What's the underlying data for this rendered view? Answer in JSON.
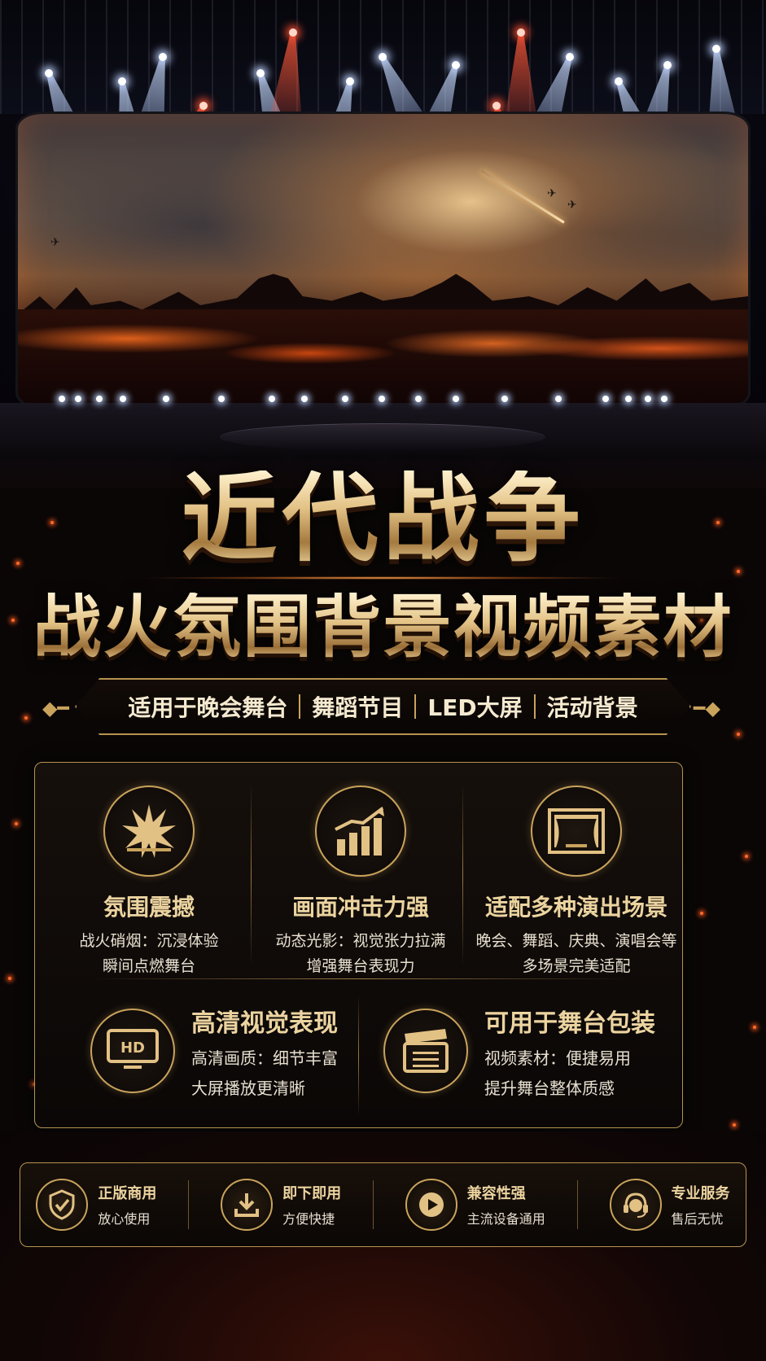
{
  "title": "近代战争",
  "subtitle": "战火氛围背景视频素材",
  "tagline": [
    "适用于晚会舞台",
    "舞蹈节目",
    "LED大屏",
    "活动背景"
  ],
  "features_top": [
    {
      "icon": "explosion-icon",
      "title": "氛围震撼",
      "lines": [
        "战火硝烟：沉浸体验",
        "瞬间点燃舞台"
      ]
    },
    {
      "icon": "chart-growth-icon",
      "title": "画面冲击力强",
      "lines": [
        "动态光影：视觉张力拉满",
        "增强舞台表现力"
      ]
    },
    {
      "icon": "stage-curtain-icon",
      "title": "适配多种演出场景",
      "lines": [
        "晚会、舞蹈、庆典、演唱会等",
        "多场景完美适配"
      ]
    }
  ],
  "features_bottom": [
    {
      "icon": "hd-monitor-icon",
      "title": "高清视觉表现",
      "lines": [
        "高清画质：细节丰富",
        "大屏播放更清晰"
      ]
    },
    {
      "icon": "clapperboard-icon",
      "title": "可用于舞台包装",
      "lines": [
        "视频素材：便捷易用",
        "提升舞台整体质感"
      ]
    }
  ],
  "badges": [
    {
      "icon": "shield-check-icon",
      "title": "正版商用",
      "sub": "放心使用"
    },
    {
      "icon": "download-icon",
      "title": "即下即用",
      "sub": "方便快捷"
    },
    {
      "icon": "play-icon",
      "title": "兼容性强",
      "sub": "主流设备通用"
    },
    {
      "icon": "headset-support-icon",
      "title": "专业服务",
      "sub": "售后无忧"
    }
  ],
  "colors": {
    "gold": "#c9a35c",
    "gold_light": "#ecd4a0",
    "background": "#0a0606",
    "ember": "#ff6a2a"
  }
}
